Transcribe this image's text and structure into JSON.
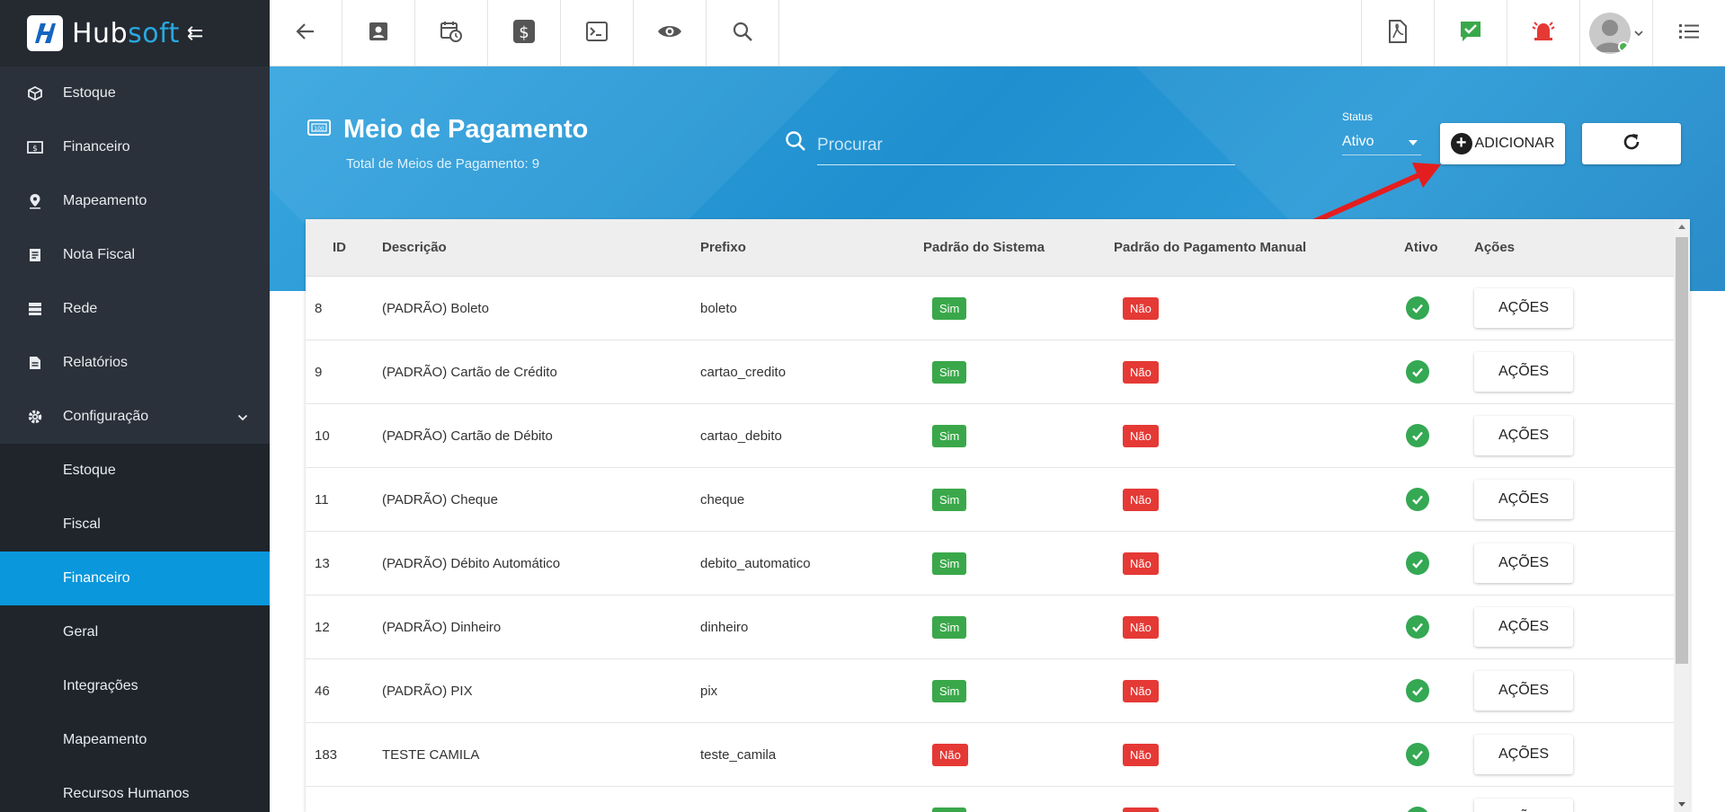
{
  "brand": {
    "hub": "Hub",
    "soft": "soft",
    "collapse_glyph": "⇇"
  },
  "sidebar": {
    "items": [
      {
        "label": "Estoque",
        "icon": "box-icon"
      },
      {
        "label": "Financeiro",
        "icon": "money-icon"
      },
      {
        "label": "Mapeamento",
        "icon": "map-pin-icon"
      },
      {
        "label": "Nota Fiscal",
        "icon": "document-icon"
      },
      {
        "label": "Rede",
        "icon": "server-icon"
      },
      {
        "label": "Relatórios",
        "icon": "report-icon"
      },
      {
        "label": "Configuração",
        "icon": "gear-icon"
      }
    ],
    "sub_items": [
      {
        "label": "Estoque"
      },
      {
        "label": "Fiscal"
      },
      {
        "label": "Financeiro"
      },
      {
        "label": "Geral"
      },
      {
        "label": "Integrações"
      },
      {
        "label": "Mapeamento"
      },
      {
        "label": "Recursos Humanos"
      }
    ]
  },
  "page": {
    "title": "Meio de Pagamento",
    "subtitle": "Total de Meios de Pagamento: 9",
    "search_placeholder": "Procurar",
    "status_label": "Status",
    "status_value": "Ativo",
    "add_label": "ADICIONAR"
  },
  "table": {
    "headers": {
      "id": "ID",
      "descricao": "Descrição",
      "prefixo": "Prefixo",
      "padrao_sistema": "Padrão do Sistema",
      "padrao_manual": "Padrão do Pagamento Manual",
      "ativo": "Ativo",
      "acoes": "Ações"
    },
    "action_label": "AÇÕES",
    "rows": [
      {
        "id": "8",
        "descricao": "(PADRÃO) Boleto",
        "prefixo": "boleto",
        "sistema": "Sim",
        "manual": "Não"
      },
      {
        "id": "9",
        "descricao": "(PADRÃO) Cartão de Crédito",
        "prefixo": "cartao_credito",
        "sistema": "Sim",
        "manual": "Não"
      },
      {
        "id": "10",
        "descricao": "(PADRÃO) Cartão de Débito",
        "prefixo": "cartao_debito",
        "sistema": "Sim",
        "manual": "Não"
      },
      {
        "id": "11",
        "descricao": "(PADRÃO) Cheque",
        "prefixo": "cheque",
        "sistema": "Sim",
        "manual": "Não"
      },
      {
        "id": "13",
        "descricao": "(PADRÃO) Débito Automático",
        "prefixo": "debito_automatico",
        "sistema": "Sim",
        "manual": "Não"
      },
      {
        "id": "12",
        "descricao": "(PADRÃO) Dinheiro",
        "prefixo": "dinheiro",
        "sistema": "Sim",
        "manual": "Não"
      },
      {
        "id": "46",
        "descricao": "(PADRÃO) PIX",
        "prefixo": "pix",
        "sistema": "Sim",
        "manual": "Não"
      },
      {
        "id": "183",
        "descricao": "TESTE CAMILA",
        "prefixo": "teste_camila",
        "sistema": "Não",
        "manual": "Não"
      },
      {
        "id": "",
        "descricao": "",
        "prefixo": "",
        "sistema": "Sim",
        "manual": "Não"
      }
    ]
  },
  "colors": {
    "sidebar": "#2b313a",
    "active": "#0a97db",
    "band": "#1f8fcf",
    "sim": "#3aa84a",
    "nao": "#e53935"
  }
}
